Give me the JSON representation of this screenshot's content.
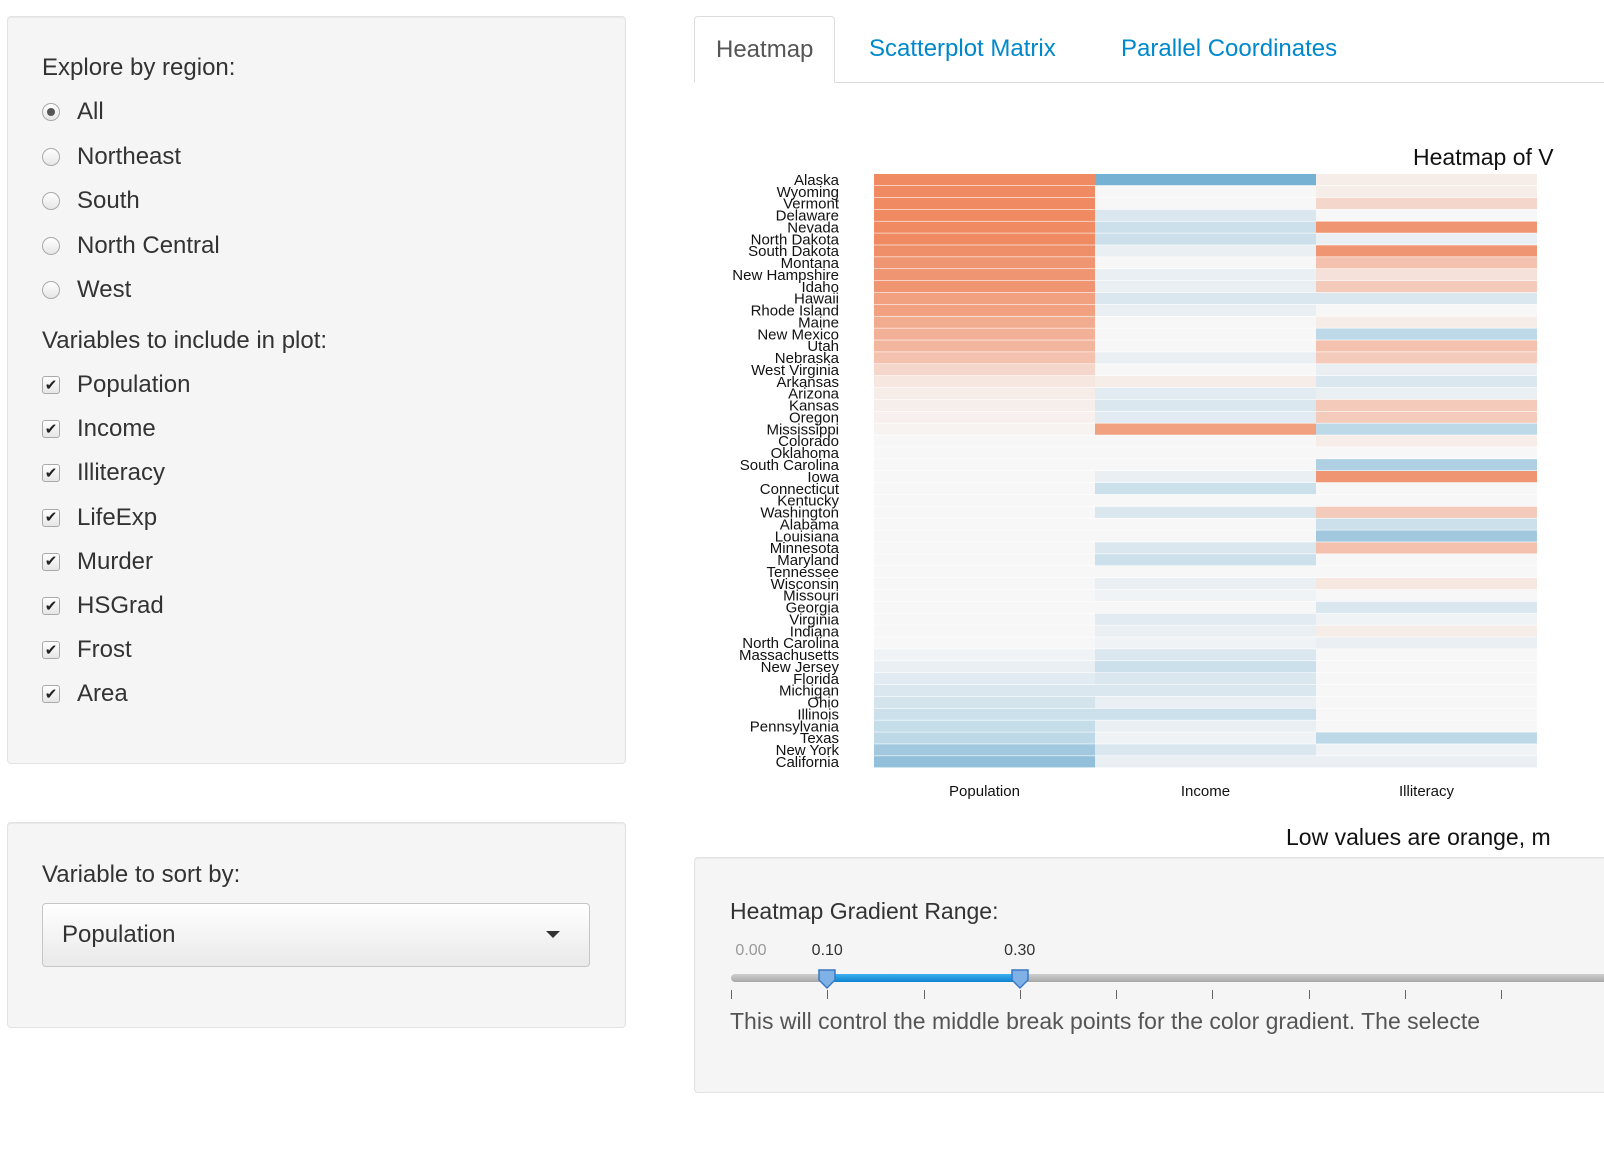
{
  "sidebar": {
    "region_label": "Explore by region:",
    "regions": [
      {
        "label": "All",
        "selected": true
      },
      {
        "label": "Northeast",
        "selected": false
      },
      {
        "label": "South",
        "selected": false
      },
      {
        "label": "North Central",
        "selected": false
      },
      {
        "label": "West",
        "selected": false
      }
    ],
    "variables_label": "Variables to include in plot:",
    "variables": [
      {
        "label": "Population",
        "checked": true
      },
      {
        "label": "Income",
        "checked": true
      },
      {
        "label": "Illiteracy",
        "checked": true
      },
      {
        "label": "LifeExp",
        "checked": true
      },
      {
        "label": "Murder",
        "checked": true
      },
      {
        "label": "HSGrad",
        "checked": true
      },
      {
        "label": "Frost",
        "checked": true
      },
      {
        "label": "Area",
        "checked": true
      }
    ],
    "sort_label": "Variable to sort by:",
    "sort_value": "Population",
    "check_glyph": "✔"
  },
  "tabs": [
    {
      "label": "Heatmap",
      "active": true
    },
    {
      "label": "Scatterplot Matrix",
      "active": false
    },
    {
      "label": "Parallel Coordinates",
      "active": false
    }
  ],
  "plot": {
    "title": "Heatmap of V",
    "caption": "Low values are orange, m"
  },
  "chart_data": {
    "type": "heatmap",
    "title": "Heatmap of V",
    "columns": [
      "Population",
      "Income",
      "Illiteracy"
    ],
    "rows": [
      "Alaska",
      "Wyoming",
      "Vermont",
      "Delaware",
      "Nevada",
      "North Dakota",
      "South Dakota",
      "Montana",
      "New Hampshire",
      "Idaho",
      "Hawaii",
      "Rhode Island",
      "Maine",
      "New Mexico",
      "Utah",
      "Nebraska",
      "West Virginia",
      "Arkansas",
      "Arizona",
      "Kansas",
      "Oregon",
      "Mississippi",
      "Colorado",
      "Oklahoma",
      "South Carolina",
      "Iowa",
      "Connecticut",
      "Kentucky",
      "Washington",
      "Alabama",
      "Louisiana",
      "Minnesota",
      "Maryland",
      "Tennessee",
      "Wisconsin",
      "Missouri",
      "Georgia",
      "Virginia",
      "Indiana",
      "North Carolina",
      "Massachusetts",
      "New Jersey",
      "Florida",
      "Michigan",
      "Ohio",
      "Illinois",
      "Pennsylvania",
      "Texas",
      "New York",
      "California"
    ],
    "color_scale": {
      "low": "#ef8a62",
      "mid": "#f7f7f7",
      "high": "#67a9cf"
    },
    "values": [
      [
        -1.0,
        0.9,
        -0.1
      ],
      [
        -1.0,
        0,
        -0.1
      ],
      [
        -1.0,
        0,
        -0.3
      ],
      [
        -1.0,
        0.2,
        0
      ],
      [
        -1.0,
        0.3,
        -0.9
      ],
      [
        -1.0,
        0.3,
        0.1
      ],
      [
        -0.95,
        0.1,
        -0.9
      ],
      [
        -0.9,
        0,
        -0.5
      ],
      [
        -0.9,
        0.1,
        -0.2
      ],
      [
        -0.9,
        0.1,
        -0.4
      ],
      [
        -0.8,
        0.2,
        0.2
      ],
      [
        -0.8,
        0.1,
        0
      ],
      [
        -0.7,
        0,
        -0.1
      ],
      [
        -0.65,
        0,
        0.4
      ],
      [
        -0.6,
        0,
        -0.5
      ],
      [
        -0.5,
        0.1,
        -0.4
      ],
      [
        -0.3,
        0,
        0.1
      ],
      [
        -0.15,
        -0.1,
        0.2
      ],
      [
        -0.1,
        0.15,
        0.1
      ],
      [
        -0.08,
        0.2,
        -0.4
      ],
      [
        -0.06,
        0.15,
        -0.4
      ],
      [
        -0.04,
        -0.8,
        0.4
      ],
      [
        0,
        0,
        -0.1
      ],
      [
        0,
        0,
        0
      ],
      [
        0,
        0,
        0.5
      ],
      [
        0,
        0.1,
        -0.9
      ],
      [
        0,
        0.3,
        0
      ],
      [
        0,
        0,
        0
      ],
      [
        0,
        0.2,
        -0.4
      ],
      [
        0,
        0,
        0.3
      ],
      [
        0,
        0,
        0.6
      ],
      [
        0,
        0.2,
        -0.5
      ],
      [
        0,
        0.3,
        0
      ],
      [
        0,
        0,
        0
      ],
      [
        0,
        0.1,
        -0.15
      ],
      [
        0,
        0.05,
        0
      ],
      [
        0,
        0,
        0.2
      ],
      [
        0,
        0.15,
        0.05
      ],
      [
        0,
        0.1,
        -0.1
      ],
      [
        0,
        0.05,
        0.1
      ],
      [
        0.05,
        0.2,
        0
      ],
      [
        0.1,
        0.3,
        0
      ],
      [
        0.15,
        0.2,
        0
      ],
      [
        0.2,
        0.2,
        0
      ],
      [
        0.25,
        0.1,
        0
      ],
      [
        0.3,
        0.3,
        0
      ],
      [
        0.35,
        0.1,
        0
      ],
      [
        0.4,
        0.05,
        0.4
      ],
      [
        0.6,
        0.2,
        0.05
      ],
      [
        0.7,
        0.1,
        0.1
      ]
    ]
  },
  "slider": {
    "label": "Heatmap Gradient Range:",
    "min_label": "0.00",
    "min": 0,
    "max": 0.9,
    "low_value": 0.1,
    "high_value": 0.3,
    "low_label": "0.10",
    "high_label": "0.30",
    "help": "This will control the middle break points for the color gradient. The selecte",
    "accent": "#0c83cf"
  }
}
